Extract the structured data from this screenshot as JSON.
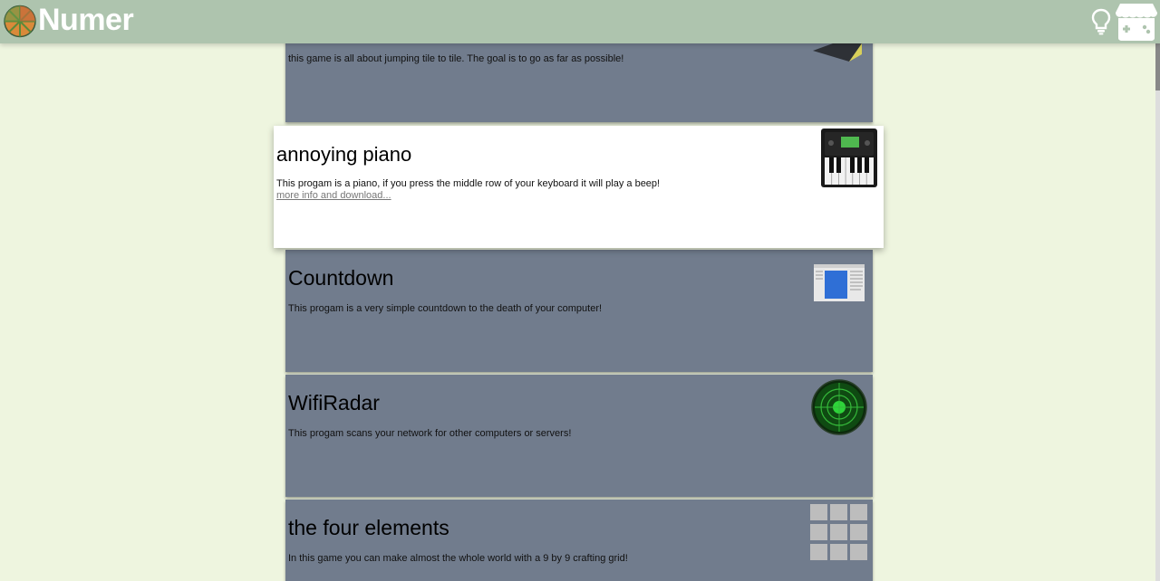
{
  "header": {
    "brand": "Numer",
    "icons": [
      "numer-logo-icon",
      "lightbulb-icon",
      "itch-io-icon"
    ]
  },
  "cards": [
    {
      "title": "",
      "description": "this game is all about jumping tile to tile. The goal is to go as far as possible!",
      "thumb": "tile-jump-thumb-icon"
    },
    {
      "title": "annoying piano",
      "description": "This progam is a piano, if you press the middle row of your keyboard it will play a beep!",
      "link": "more info and download...",
      "thumb": "piano-keyboard-icon"
    },
    {
      "title": "Countdown",
      "description": "This progam is a very simple countdown to the death of your computer!",
      "thumb": "countdown-window-icon"
    },
    {
      "title": "WifiRadar",
      "description": "This progam scans your network for other computers or servers!",
      "thumb": "radar-icon"
    },
    {
      "title": "the four elements",
      "description": "In this game you can make almost the whole world with a 9 by 9 crafting grid!",
      "thumb": "crafting-grid-icon"
    }
  ],
  "colors": {
    "header": "#aec4ae",
    "background": "#eef5df",
    "card": "#717c8d",
    "highlight_card": "#ffffff"
  }
}
